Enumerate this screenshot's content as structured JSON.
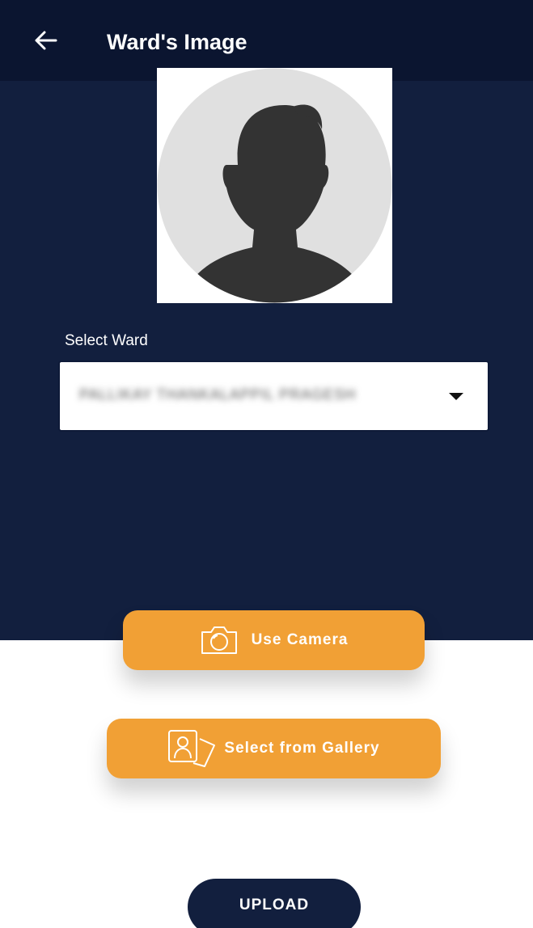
{
  "header": {
    "title": "Ward's Image",
    "back_icon": "arrow-left-icon"
  },
  "avatar": {
    "icon": "default-user-avatar-icon"
  },
  "ward_select": {
    "label": "Select Ward",
    "value": "PALLIKAY THANKALAPPIL PRAGESH"
  },
  "actions": {
    "camera_label": "Use Camera",
    "camera_icon": "camera-icon",
    "gallery_label": "Select from Gallery",
    "gallery_icon": "gallery-icon",
    "upload_label": "UPLOAD"
  },
  "colors": {
    "header_bg": "#0b1530",
    "panel_bg": "#121f3e",
    "accent_orange": "#f1a035"
  }
}
